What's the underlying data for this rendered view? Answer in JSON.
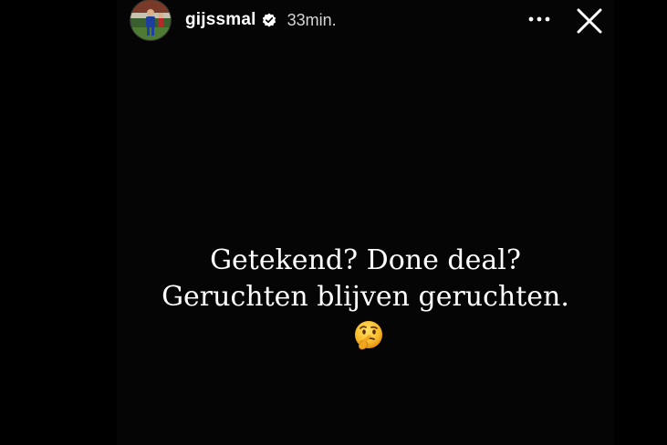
{
  "story": {
    "username": "gijssmal",
    "timestamp": "33min.",
    "text_lines": [
      "Getekend? Done deal?",
      "Geruchten blijven geruchten."
    ],
    "emoji": "thinking-face"
  },
  "icons": {
    "verified": "verified-badge-icon",
    "more": "more-options-icon",
    "close": "close-icon"
  },
  "colors": {
    "background": "#000000",
    "text": "#ffffff",
    "timestamp": "#d6d6d6"
  }
}
